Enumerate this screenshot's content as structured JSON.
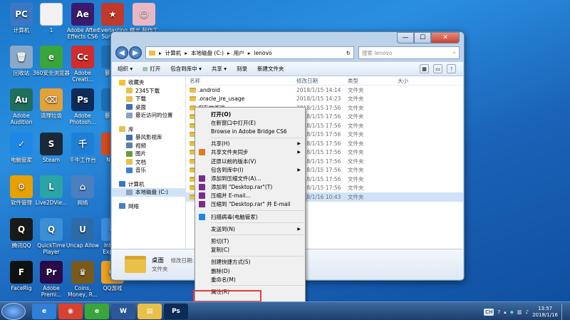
{
  "desktop": {
    "icons": [
      {
        "label": "计算机",
        "color": "#3b78c4",
        "glyph": "PC",
        "col": 0,
        "row": 0
      },
      {
        "label": "1",
        "color": "#f2f2f2",
        "glyph": "",
        "col": 1,
        "row": 0
      },
      {
        "label": "Adobe After Effects CS6",
        "color": "#3a1a6e",
        "glyph": "Ae",
        "col": 2,
        "row": 0
      },
      {
        "label": "Everlasting Summ...",
        "color": "#c0392b",
        "glyph": "★",
        "col": 3,
        "row": 0
      },
      {
        "label": "樱光 制作工",
        "color": "#e9b7c4",
        "glyph": "☺",
        "col": 4,
        "row": 0
      },
      {
        "label": "回收站",
        "color": "#8aa9c9",
        "glyph": "🗑",
        "col": 0,
        "row": 1
      },
      {
        "label": "360安全浏览器",
        "color": "#3aa53a",
        "glyph": "e",
        "col": 1,
        "row": 1
      },
      {
        "label": "Adobe Creati...",
        "color": "#d32c2c",
        "glyph": "Cc",
        "col": 2,
        "row": 1
      },
      {
        "label": "暴风...",
        "color": "#1f6fb5",
        "glyph": "",
        "col": 3,
        "row": 1
      },
      {
        "label": "Adobe Audition",
        "color": "#1f6f5c",
        "glyph": "Au",
        "col": 0,
        "row": 2
      },
      {
        "label": "清理垃圾",
        "color": "#e2a13a",
        "glyph": "⌫",
        "col": 1,
        "row": 2
      },
      {
        "label": "Adobe Photosh...",
        "color": "#0c2c57",
        "glyph": "Ps",
        "col": 2,
        "row": 2
      },
      {
        "label": "暴风...",
        "color": "#1f6fb5",
        "glyph": "",
        "col": 3,
        "row": 2
      },
      {
        "label": "电脑管家",
        "color": "#1e88e5",
        "glyph": "✓",
        "col": 0,
        "row": 3
      },
      {
        "label": "Steam",
        "color": "#1b2838",
        "glyph": "S",
        "col": 1,
        "row": 3
      },
      {
        "label": "千牛工作台",
        "color": "#1e7fd6",
        "glyph": "千",
        "col": 2,
        "row": 3
      },
      {
        "label": "NEW",
        "color": "#d84b1e",
        "glyph": "",
        "col": 3,
        "row": 3
      },
      {
        "label": "软件管理",
        "color": "#e7a100",
        "glyph": "⚙",
        "col": 0,
        "row": 4
      },
      {
        "label": "Live2DVie...",
        "color": "#2aa4a4",
        "glyph": "L",
        "col": 1,
        "row": 4
      },
      {
        "label": "网络",
        "color": "#4a7fc1",
        "glyph": "⌂",
        "col": 2,
        "row": 4
      },
      {
        "label": "腾讯QQ",
        "color": "#1a1a1a",
        "glyph": "Q",
        "col": 0,
        "row": 5
      },
      {
        "label": "QuickTime Player",
        "color": "#3b8fd4",
        "glyph": "Q",
        "col": 1,
        "row": 5
      },
      {
        "label": "Uncap Allow",
        "color": "#2d6aa8",
        "glyph": "U",
        "col": 2,
        "row": 5
      },
      {
        "label": "Inter... Explo...",
        "color": "#3c8de0",
        "glyph": "e",
        "col": 3,
        "row": 5
      },
      {
        "label": "FaceRig",
        "color": "#111111",
        "glyph": "F",
        "col": 0,
        "row": 6
      },
      {
        "label": "Adobe Premi...",
        "color": "#2a0a4a",
        "glyph": "Pr",
        "col": 1,
        "row": 6
      },
      {
        "label": "Coins, Money, R...",
        "color": "#7a5a1a",
        "glyph": "♛",
        "col": 2,
        "row": 6
      },
      {
        "label": "QQ游戏",
        "color": "#f3a21c",
        "glyph": "Q",
        "col": 3,
        "row": 6
      }
    ]
  },
  "explorer": {
    "window_buttons": [
      "—",
      "☐",
      "✕"
    ],
    "address": {
      "segments": [
        "计算机",
        "本地磁盘 (C:)",
        "用户",
        "lenovo"
      ]
    },
    "search_placeholder": "搜索 lenovo",
    "toolbar": [
      "组织 ▾",
      "打开",
      "包含到库中 ▾",
      "共享 ▾",
      "刻录",
      "新建文件夹"
    ],
    "nav": [
      {
        "label": "收藏夹",
        "kind": "section",
        "color": "#f2c230"
      },
      {
        "label": "2345下载",
        "kind": "child",
        "color": "#e8c04a"
      },
      {
        "label": "下载",
        "kind": "child",
        "color": "#e8c04a"
      },
      {
        "label": "桌面",
        "kind": "child",
        "color": "#3b6fb5"
      },
      {
        "label": "最近访问的位置",
        "kind": "child",
        "color": "#8aa3c0"
      },
      {
        "label": "",
        "kind": "gap",
        "color": ""
      },
      {
        "label": "库",
        "kind": "section",
        "color": "#e8c04a"
      },
      {
        "label": "暴风影视库",
        "kind": "child",
        "color": "#3b6fb5"
      },
      {
        "label": "视频",
        "kind": "child",
        "color": "#5b7fa8"
      },
      {
        "label": "图片",
        "kind": "child",
        "color": "#6a9a3a"
      },
      {
        "label": "文档",
        "kind": "child",
        "color": "#e8c04a"
      },
      {
        "label": "音乐",
        "kind": "child",
        "color": "#3b7fd4"
      },
      {
        "label": "",
        "kind": "gap",
        "color": ""
      },
      {
        "label": "计算机",
        "kind": "section",
        "color": "#3b78c4"
      },
      {
        "label": "本地磁盘 (C:)",
        "kind": "child-sel",
        "color": "#8aa3c0"
      },
      {
        "label": "",
        "kind": "gap",
        "color": ""
      },
      {
        "label": "网络",
        "kind": "section",
        "color": "#4a7fc1"
      }
    ],
    "columns": {
      "name": "名称",
      "date": "修改日期",
      "type": "类型",
      "size": "大小"
    },
    "files": [
      {
        "name": ".android",
        "date": "2018/1/15 14:14",
        "type": "文件夹",
        "sel": false
      },
      {
        "name": ".oracle_jre_usage",
        "date": "2018/1/15 14:23",
        "type": "文件夹",
        "sel": false
      },
      {
        "name": "保存的游戏",
        "date": "2018/1/15 17:56",
        "type": "文件夹",
        "sel": false
      },
      {
        "name": "",
        "date": "2018/1/15 17:56",
        "type": "文件夹",
        "sel": false
      },
      {
        "name": "",
        "date": "2018/1/15 17:56",
        "type": "文件夹",
        "sel": false
      },
      {
        "name": "",
        "date": "2018/1/15 17:56",
        "type": "文件夹",
        "sel": false
      },
      {
        "name": "",
        "date": "2018/1/15 17:56",
        "type": "文件夹",
        "sel": false
      },
      {
        "name": "",
        "date": "2018/1/15 17:56",
        "type": "文件夹",
        "sel": false
      },
      {
        "name": "",
        "date": "2018/1/15 17:56",
        "type": "文件夹",
        "sel": false
      },
      {
        "name": "",
        "date": "2018/1/15 17:56",
        "type": "文件夹",
        "sel": false
      },
      {
        "name": "",
        "date": "2018/1/15 17:56",
        "type": "文件夹",
        "sel": false
      },
      {
        "name": "",
        "date": "2018/1/15 17:56",
        "type": "文件夹",
        "sel": false
      },
      {
        "name": "桌面",
        "date": "2018/1/16 10:43",
        "type": "文件夹",
        "sel": true
      }
    ],
    "details": {
      "name": "桌面",
      "label": "修改日期: 2018",
      "type": "文件夹"
    }
  },
  "context_menu": {
    "items": [
      {
        "label": "打开(O)",
        "bold": true,
        "icon": "",
        "submenu": false
      },
      {
        "label": "在新窗口中打开(E)",
        "icon": "",
        "submenu": false
      },
      {
        "label": "Browse in Adobe Bridge CS6",
        "icon": "",
        "submenu": false
      },
      {
        "sep": true
      },
      {
        "label": "共享(H)",
        "icon": "",
        "submenu": true
      },
      {
        "label": "共享文件夹同步",
        "icon": "#e07a1a",
        "submenu": true
      },
      {
        "label": "还原以前的版本(V)",
        "icon": "",
        "submenu": false
      },
      {
        "label": "包含到库中(I)",
        "icon": "",
        "submenu": true
      },
      {
        "label": "添加到压缩文件(A)...",
        "icon": "#7a2a8a",
        "submenu": false
      },
      {
        "label": "添加到 \"Desktop.rar\"(T)",
        "icon": "#7a2a8a",
        "submenu": false
      },
      {
        "label": "压缩并 E-mail...",
        "icon": "#7a2a8a",
        "submenu": false
      },
      {
        "label": "压缩到 \"Desktop.rar\" 并 E-mail",
        "icon": "#7a2a8a",
        "submenu": false
      },
      {
        "sep": true
      },
      {
        "label": "扫描病毒(电脑管家)",
        "icon": "#1e88e5",
        "submenu": false
      },
      {
        "sep": true
      },
      {
        "label": "发送到(N)",
        "icon": "",
        "submenu": true
      },
      {
        "sep": true
      },
      {
        "label": "剪切(T)",
        "icon": "",
        "submenu": false
      },
      {
        "label": "复制(C)",
        "icon": "",
        "submenu": false
      },
      {
        "sep": true
      },
      {
        "label": "创建快捷方式(S)",
        "icon": "",
        "submenu": false
      },
      {
        "label": "删除(D)",
        "icon": "",
        "submenu": false
      },
      {
        "label": "重命名(M)",
        "icon": "",
        "submenu": false
      },
      {
        "sep": true
      },
      {
        "label": "属性(R)",
        "icon": "",
        "submenu": false
      }
    ]
  },
  "taskbar": {
    "apps": [
      {
        "label": "e",
        "color": "#2f7fd8"
      },
      {
        "label": "◉",
        "color": "#d8412f"
      },
      {
        "label": "e",
        "color": "#3aa53a"
      },
      {
        "label": "W",
        "color": "#2b5797"
      },
      {
        "label": "▤",
        "color": "#e8c04a"
      },
      {
        "label": "Ps",
        "color": "#0c2c57"
      }
    ],
    "ime": "CH",
    "time": "13:57",
    "date": "2018/1/16"
  },
  "colors": {
    "highlight_box": "#e53d3d",
    "selection": "#cfe3f8"
  }
}
